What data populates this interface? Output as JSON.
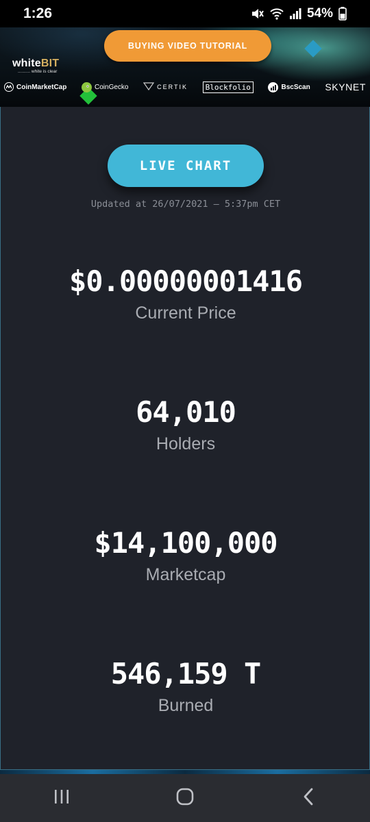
{
  "status_bar": {
    "time": "1:26",
    "battery_percent": "54%",
    "icons": [
      "mute-icon",
      "wifi-icon",
      "signal-icon",
      "battery-icon"
    ]
  },
  "banner": {
    "tutorial_button": "BUYING VIDEO TUTORIAL",
    "whitebit": {
      "brand_white": "white",
      "brand_gold": "BIT",
      "tagline": "white is clear"
    },
    "partners": {
      "coinmarketcap": "CoinMarketCap",
      "coingecko": "CoinGecko",
      "certik": "CERTIK",
      "blockfolio": "Blockfolio",
      "bscscan": "BscScan",
      "skynet": "SKYNET"
    }
  },
  "main": {
    "live_chart_button": "LIVE CHART",
    "updated_text": "Updated at 26/07/2021 – 5:37pm CET",
    "stats": {
      "price": {
        "value": "$0.00000001416",
        "label": "Current Price"
      },
      "holders": {
        "value": "64,010",
        "label": "Holders"
      },
      "marketcap": {
        "value": "$14,100,000",
        "label": "Marketcap"
      },
      "burned": {
        "value": "546,159 T",
        "label": "Burned"
      }
    }
  },
  "colors": {
    "accent_orange": "#f09a36",
    "accent_cyan": "#41b7d7",
    "card_bg": "#1f222a"
  }
}
